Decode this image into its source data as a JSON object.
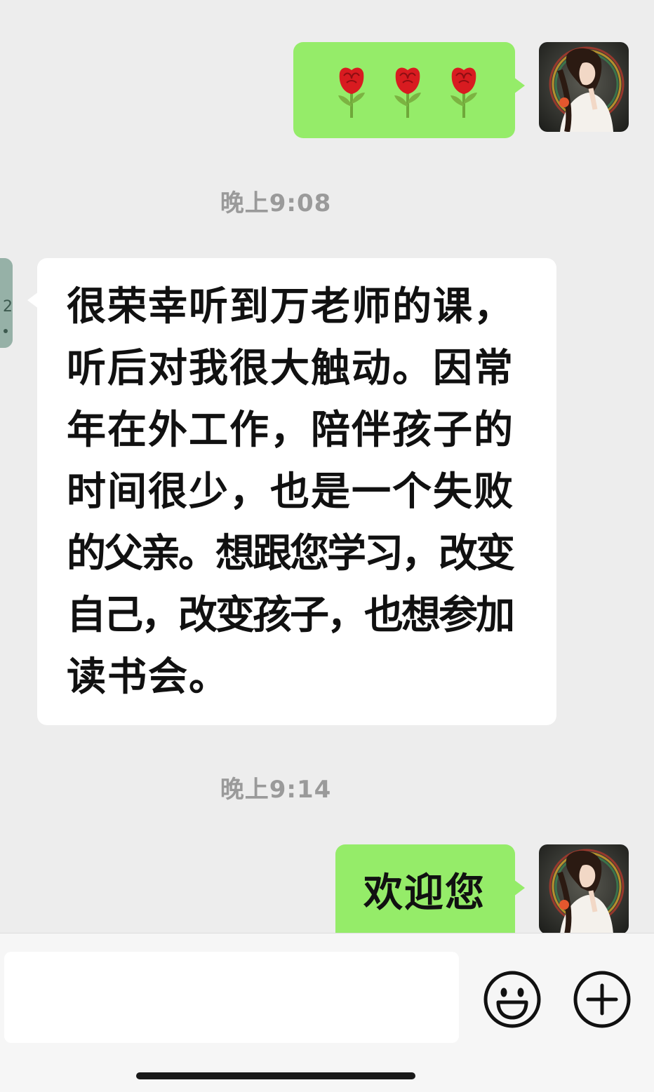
{
  "messages": [
    {
      "type": "sent",
      "content": "🌹🌹🌹"
    },
    {
      "type": "timestamp",
      "text": "晚上9:08"
    },
    {
      "type": "received",
      "lines": [
        "很荣幸听到万老师的课，",
        "听后对我很大触动。因常",
        "年在外工作，陪伴孩子的",
        "时间很少，也是一个失败",
        "的父亲。想跟您学习，改变",
        "自己，改变孩子，也想参加",
        "读书会。"
      ]
    },
    {
      "type": "timestamp",
      "text": "晚上9:14"
    },
    {
      "type": "sent",
      "text": "欢迎您"
    }
  ],
  "input": {
    "value": "",
    "placeholder": ""
  },
  "icons": {
    "emoji": "smiley-face-icon",
    "more": "plus-circle-icon"
  },
  "colors": {
    "background": "#ededed",
    "sent_bubble": "#95ec69",
    "received_bubble": "#ffffff",
    "timestamp_text": "#9a9a9a",
    "message_text": "#111111"
  }
}
